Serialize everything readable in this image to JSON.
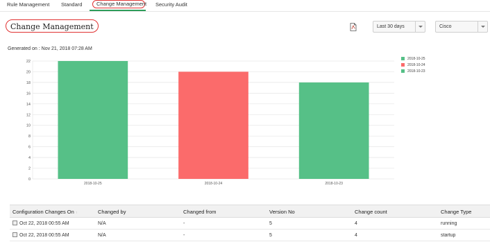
{
  "tabs": [
    {
      "label": "Rule Management"
    },
    {
      "label": "Standard"
    },
    {
      "label": "Change Management"
    },
    {
      "label": "Security Audit"
    }
  ],
  "header": {
    "title": "Change Management",
    "period": "Last 30 days",
    "device": "Cisco",
    "generated": "Generated on :  Nov 21, 2018 07:28 AM"
  },
  "chart_data": {
    "type": "bar",
    "categories": [
      "2018-10-25",
      "2018-10-24",
      "2018-10-23"
    ],
    "values": [
      22,
      20,
      18
    ],
    "colors": [
      "#56c087",
      "#fb6b6b",
      "#56c087"
    ],
    "ylim": [
      0,
      22
    ],
    "yticks": [
      0,
      2,
      4,
      6,
      8,
      10,
      12,
      14,
      16,
      18,
      20,
      22
    ],
    "grid": true,
    "legend": [
      {
        "label": "2018-10-25",
        "color": "#56c087"
      },
      {
        "label": "2018-10-24",
        "color": "#fb6b6b"
      },
      {
        "label": "2018-10-23",
        "color": "#56c087"
      }
    ],
    "legend_position": "top-right"
  },
  "table": {
    "headers": [
      "Configuration Changes On",
      "Changed by",
      "Changed from",
      "Version No",
      "Change count",
      "Change Type"
    ],
    "rows": [
      [
        "Oct 22, 2018 00:55 AM",
        "N/A",
        "-",
        "5",
        "4",
        "running"
      ],
      [
        "Oct 22, 2018 00:55 AM",
        "N/A",
        "-",
        "5",
        "4",
        "startup"
      ]
    ]
  }
}
